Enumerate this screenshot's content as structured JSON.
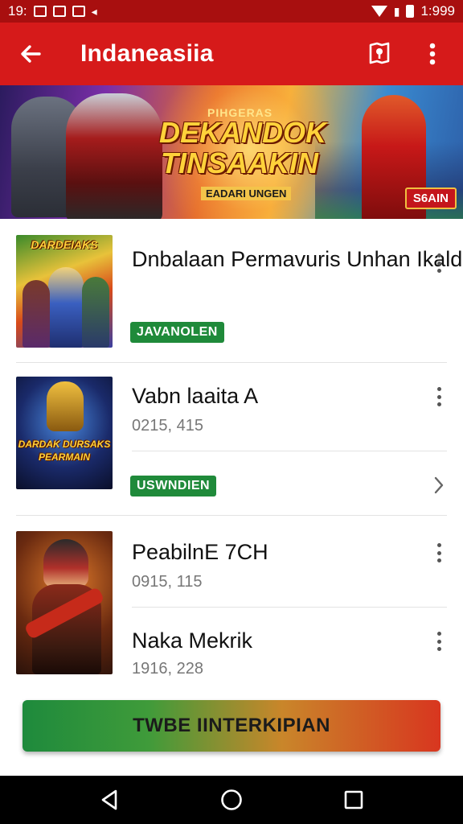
{
  "status_bar": {
    "left_time": "19:",
    "right_time": "1:999"
  },
  "app_bar": {
    "title": "Indaneasiia",
    "icons": [
      "back-arrow-icon",
      "map-pin-icon",
      "more-vert-icon"
    ]
  },
  "banner": {
    "small_heading": "PIHGERAS",
    "headline": "DEKANDOK TINSAAKIN",
    "subline": "EADARI UNGEN",
    "badge": "S6AIN"
  },
  "list": {
    "items": [
      {
        "title": "Dnbalaan Permavuris Unhan Ikald",
        "subtitle": "",
        "pill": "JAVANOLEN",
        "thumb_title": "DARDEIAKS",
        "action_icon": "more-vert-icon"
      },
      {
        "title": "Vabn laaita A",
        "subtitle": "0215, 415",
        "pill": "USWNDIEN",
        "thumb_title": "DARDAK DURSAKS PEARMAIN",
        "action_icon": "chevron-right-icon"
      },
      {
        "title": "PeabilnE 7CH",
        "subtitle": "0915, 115",
        "pill": "",
        "thumb_title": "",
        "action_icon": "more-vert-icon"
      },
      {
        "title": "Naka Mekrik",
        "subtitle": "1916, 228",
        "pill": "",
        "thumb_title": "",
        "action_icon": "more-vert-icon"
      }
    ]
  },
  "cta": {
    "label": "TWBE IINTERKIPIAN"
  },
  "colors": {
    "primary": "#d61a1a",
    "status_bar": "#a80f0f",
    "accent_green": "#1f8a3a"
  }
}
